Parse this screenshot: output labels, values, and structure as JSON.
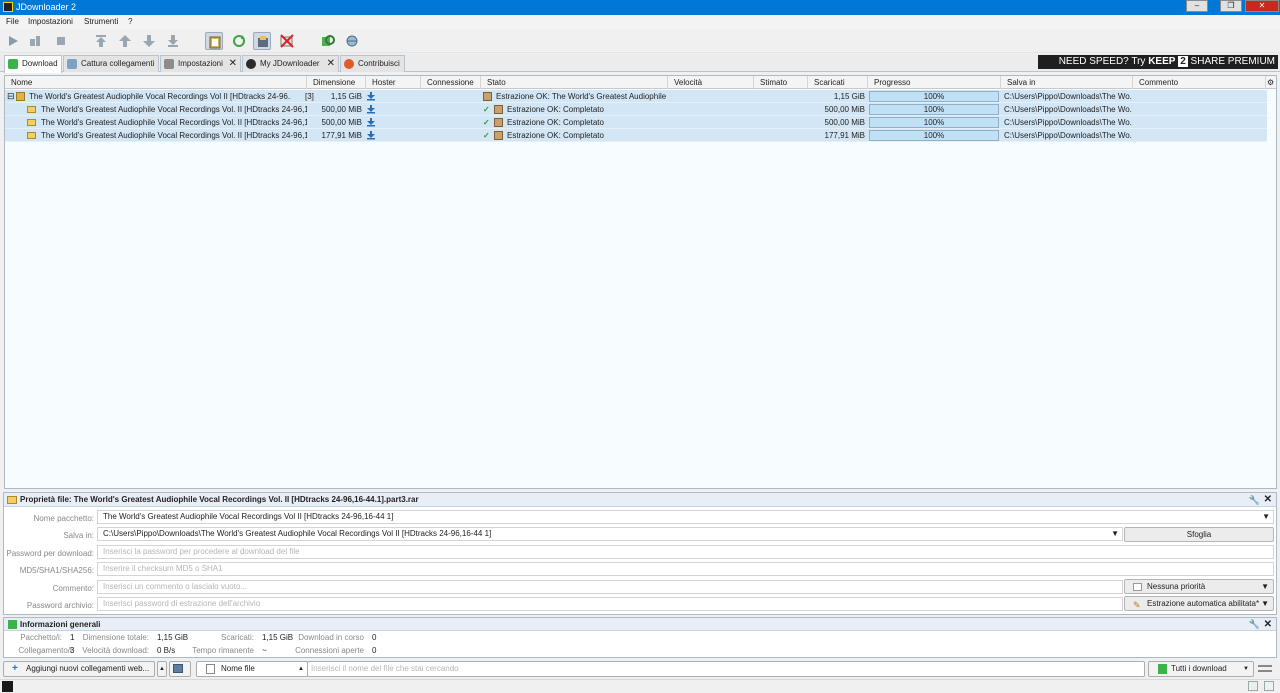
{
  "window": {
    "title": "JDownloader 2",
    "minimize": "–",
    "maximize": "❐",
    "close": "✕"
  },
  "menu": [
    "File",
    "Impostazioni",
    "Strumenti",
    "?"
  ],
  "tabs": [
    {
      "label": "Download",
      "closable": false
    },
    {
      "label": "Cattura collegamenti",
      "closable": false
    },
    {
      "label": "Impostazioni",
      "closable": true
    },
    {
      "label": "My JDownloader",
      "closable": true
    },
    {
      "label": "Contribuisci",
      "closable": false
    }
  ],
  "promo": {
    "prefix": "NEED SPEED? Try",
    "brand1": "KEEP",
    "brand2": "2",
    "brand3": "SHARE PREMIUM"
  },
  "columns": [
    "Nome",
    "Dimensione",
    "Hoster",
    "Connessione",
    "Stato",
    "Velocità",
    "Stimato",
    "Scaricati",
    "Progresso",
    "Salva in",
    "Commento"
  ],
  "package": {
    "name": "The World's Greatest Audiophile Vocal Recordings Vol  II [HDtracks 24-96...",
    "count": "[3]",
    "size": "1,15 GiB",
    "status": "Estrazione OK: The World's Greatest Audiophile ...",
    "downloaded": "1,15 GiB",
    "progress": "100%",
    "progress_value": 1.0,
    "save_in": "C:\\Users\\Pippo\\Downloads\\The Wo..."
  },
  "files": [
    {
      "name": "The World's Greatest Audiophile Vocal Recordings Vol. II [HDtracks 24-96,16...",
      "size": "500,00 MiB",
      "status": "Estrazione OK: Completato",
      "downloaded": "500,00 MiB",
      "progress": "100%",
      "progress_value": 1.0,
      "save_in": "C:\\Users\\Pippo\\Downloads\\The Wo..."
    },
    {
      "name": "The World's Greatest Audiophile Vocal Recordings Vol. II [HDtracks 24-96,16...",
      "size": "500,00 MiB",
      "status": "Estrazione OK: Completato",
      "downloaded": "500,00 MiB",
      "progress": "100%",
      "progress_value": 1.0,
      "save_in": "C:\\Users\\Pippo\\Downloads\\The Wo..."
    },
    {
      "name": "The World's Greatest Audiophile Vocal Recordings Vol. II [HDtracks 24-96,16...",
      "size": "177,91 MiB",
      "status": "Estrazione OK: Completato",
      "downloaded": "177,91 MiB",
      "progress": "100%",
      "progress_value": 1.0,
      "save_in": "C:\\Users\\Pippo\\Downloads\\The Wo..."
    }
  ],
  "properties": {
    "title": "Proprietà file: The World's Greatest Audiophile Vocal Recordings Vol. II [HDtracks 24-96,16-44.1].part3.rar",
    "package_name_label": "Nome pacchetto:",
    "package_name": "The World's Greatest Audiophile Vocal Recordings Vol  II [HDtracks 24-96,16-44 1]",
    "save_in_label": "Salva in:",
    "save_in": "C:\\Users\\Pippo\\Downloads\\The World's Greatest Audiophile Vocal Recordings Vol  II [HDtracks 24-96,16-44 1]",
    "browse": "Sfoglia",
    "password_label": "Password per download:",
    "password_placeholder": "Inserisci la password per procedere al download del file",
    "checksum_label": "MD5/SHA1/SHA256:",
    "checksum_placeholder": "Inserire il checksum MD5 o SHA1",
    "comment_label": "Commento:",
    "comment_placeholder": "Inserisci un commento o lascialo vuoto...",
    "priority": "Nessuna priorità",
    "archive_password_label": "Password archivio:",
    "archive_password_placeholder": "Inserisci password di estrazione dell'archivio",
    "auto_extract": "Estrazione automatica abilitata*"
  },
  "info": {
    "title": "Informazioni generali",
    "packages_label": "Pacchetto/i:",
    "packages": "1",
    "links_label": "Collegamento/i:",
    "links": "3",
    "total_size_label": "Dimensione totale:",
    "total_size": "1,15 GiB",
    "speed_label": "Velocità download:",
    "speed": "0 B/s",
    "downloaded_label": "Scaricati:",
    "downloaded": "1,15 GiB",
    "remaining_label": "Tempo rimanente",
    "remaining": "~",
    "running_label": "Download in corso",
    "running": "0",
    "connections_label": "Connessioni aperte",
    "connections": "0"
  },
  "bottom": {
    "add_links": "Aggiungi nuovi collegamenti web...",
    "search_field": "Nome file",
    "search_placeholder": "Inserisci il nome del file che stai cercando",
    "all_downloads": "Tutti i download"
  }
}
